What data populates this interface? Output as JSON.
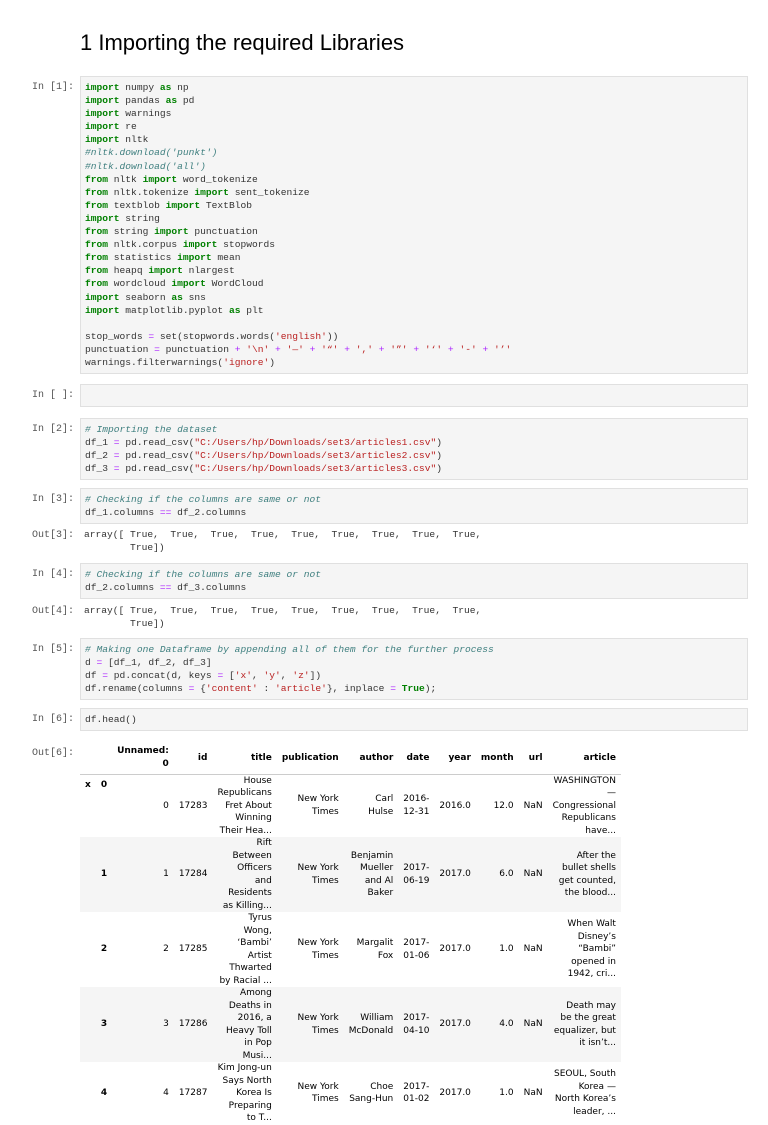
{
  "heading": "1 Importing the required Libraries",
  "cells": [
    {
      "prompt": "In [1]:",
      "lines": [
        "import numpy as np",
        "import pandas as pd",
        "import warnings",
        "import re",
        "import nltk",
        "#nltk.download('punkt')",
        "#nltk.download('all')",
        "from nltk import word_tokenize",
        "from nltk.tokenize import sent_tokenize",
        "from textblob import TextBlob",
        "import string",
        "from string import punctuation",
        "from nltk.corpus import stopwords",
        "from statistics import mean",
        "from heapq import nlargest",
        "from wordcloud import WordCloud",
        "import seaborn as sns",
        "import matplotlib.pyplot as plt",
        "",
        "stop_words = set(stopwords.words('english'))",
        "punctuation = punctuation + '\\n' + '—' + '“' + ',' + '”' + '‘' + '-' + '’'",
        "warnings.filterwarnings('ignore')"
      ]
    },
    {
      "prompt": "In [ ]:",
      "lines": [
        ""
      ]
    },
    {
      "prompt": "In [2]:",
      "lines": [
        "# Importing the dataset",
        "df_1 = pd.read_csv(\"C:/Users/hp/Downloads/set3/articles1.csv\")",
        "df_2 = pd.read_csv(\"C:/Users/hp/Downloads/set3/articles2.csv\")",
        "df_3 = pd.read_csv(\"C:/Users/hp/Downloads/set3/articles3.csv\")"
      ]
    },
    {
      "prompt": "In [3]:",
      "lines": [
        "# Checking if the columns are same or not",
        "df_1.columns == df_2.columns"
      ],
      "out_prompt": "Out[3]:",
      "out": [
        "array([ True,  True,  True,  True,  True,  True,  True,  True,  True,",
        "        True])"
      ]
    },
    {
      "prompt": "In [4]:",
      "lines": [
        "# Checking if the columns are same or not",
        "df_2.columns == df_3.columns"
      ],
      "out_prompt": "Out[4]:",
      "out": [
        "array([ True,  True,  True,  True,  True,  True,  True,  True,  True,",
        "        True])"
      ]
    },
    {
      "prompt": "In [5]:",
      "lines": [
        "# Making one Dataframe by appending all of them for the further process",
        "d = [df_1, df_2, df_3]",
        "df = pd.concat(d, keys = ['x', 'y', 'z'])",
        "df.rename(columns = {'content' : 'article'}, inplace = True);"
      ]
    },
    {
      "prompt": "In [6]:",
      "lines": [
        "df.head()"
      ],
      "out_prompt": "Out[6]:"
    }
  ],
  "table": {
    "columns": [
      "",
      "",
      "Unnamed: 0",
      "id",
      "title",
      "publication",
      "author",
      "date",
      "year",
      "month",
      "url",
      "article"
    ],
    "rows": [
      [
        "x",
        "0",
        "0",
        "17283",
        "House Republicans Fret About Winning Their Hea...",
        "New York Times",
        "Carl Hulse",
        "2016-12-31",
        "2016.0",
        "12.0",
        "NaN",
        "WASHINGTON — Congressional Republicans have..."
      ],
      [
        "",
        "1",
        "1",
        "17284",
        "Rift Between Officers and Residents as Killing...",
        "New York Times",
        "Benjamin Mueller and Al Baker",
        "2017-06-19",
        "2017.0",
        "6.0",
        "NaN",
        "After the bullet shells get counted, the blood..."
      ],
      [
        "",
        "2",
        "2",
        "17285",
        "Tyrus Wong, ‘Bambi’ Artist Thwarted by Racial ...",
        "New York Times",
        "Margalit Fox",
        "2017-01-06",
        "2017.0",
        "1.0",
        "NaN",
        "When Walt Disney’s “Bambi” opened in 1942, cri..."
      ],
      [
        "",
        "3",
        "3",
        "17286",
        "Among Deaths in 2016, a Heavy Toll in Pop Musi...",
        "New York Times",
        "William McDonald",
        "2017-04-10",
        "2017.0",
        "4.0",
        "NaN",
        "Death may be the great equalizer, but it isn’t..."
      ],
      [
        "",
        "4",
        "4",
        "17287",
        "Kim Jong-un Says North Korea Is Preparing to T...",
        "New York Times",
        "Choe Sang-Hun",
        "2017-01-02",
        "2017.0",
        "1.0",
        "NaN",
        "SEOUL, South Korea — North Korea’s leader, ..."
      ]
    ]
  }
}
